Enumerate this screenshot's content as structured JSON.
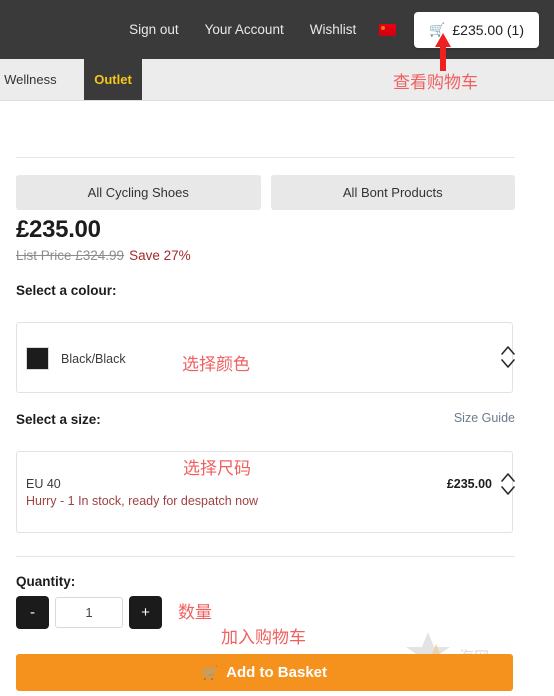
{
  "topnav": {
    "links": [
      {
        "label": "Sign out",
        "name": "sign-out"
      },
      {
        "label": "Your Account",
        "name": "your-account"
      },
      {
        "label": "Wishlist",
        "name": "wishlist"
      }
    ],
    "flag_icon": "china-flag-icon",
    "cart": {
      "icon": "shopping-cart-icon",
      "label": "£235.00 (1)"
    }
  },
  "subnav": {
    "items": [
      {
        "label": "nd Wellness",
        "name": "health-and-wellness"
      },
      {
        "label": "Outlet",
        "name": "outlet"
      }
    ]
  },
  "category_buttons": [
    {
      "label": "All Cycling Shoes",
      "name": "all-cycling-shoes"
    },
    {
      "label": "All Bont Products",
      "name": "all-bont-products"
    }
  ],
  "pricing": {
    "current_price": "£235.00",
    "list_price": "List Price £324.99",
    "save": "Save 27%"
  },
  "colour": {
    "label": "Select a colour:",
    "selected": "Black/Black",
    "swatch_hex": "#1c1c1c",
    "chevron_icon": "chevron-up-down-icon"
  },
  "size": {
    "label": "Select a size:",
    "size_guide": "Size Guide",
    "selected": "EU 40",
    "stock_message": "Hurry - 1 In stock, ready for despatch now",
    "price": "£235.00",
    "chevron_icon": "chevron-up-down-icon"
  },
  "quantity": {
    "label": "Quantity:",
    "decrement": "-",
    "value": "1",
    "increment": "+"
  },
  "add_to_basket": {
    "icon": "shopping-cart-icon",
    "label": "Add to Basket"
  },
  "annotations": {
    "cart": "查看购物车",
    "colour": "选择颜色",
    "size": "选择尺码",
    "quantity": "数量",
    "add_to_basket": "加入购物车",
    "color_hex": "#f06060"
  },
  "watermark": {
    "text": "海网",
    "icon": "star-logo-icon"
  },
  "theme": {
    "topbar_bg": "#3a3a3a",
    "outlet_accent": "#f5c518",
    "basket_orange": "#f5921e",
    "save_red": "#a32b2b"
  }
}
